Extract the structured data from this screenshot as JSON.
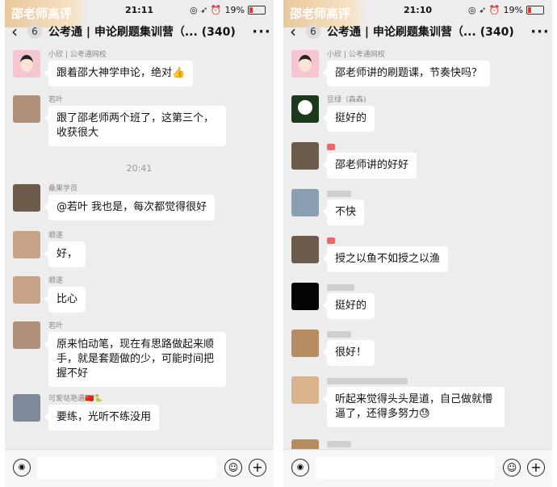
{
  "phones": [
    {
      "status": {
        "time": "21:11",
        "icons": "◎ ➶ ⏰",
        "battery": "19%"
      },
      "watermark": "邵老师高评",
      "nav": {
        "unread": "6",
        "title": "公考通 | 申论刷题集训营（...",
        "count": "(340)"
      },
      "time_separator": "20:41",
      "messages": [
        {
          "sender": "小欣 | 公考通网校",
          "text": "跟着邵大神学申论，绝对👍",
          "avatar": "avatar-pink-cartoon"
        },
        {
          "sender": "若叶",
          "text": "跟了邵老师两个班了，这第三个，收获很大",
          "avatar": "avatar-dog"
        },
        {
          "sender": "桑果学员",
          "text": "@若叶 我也是，每次都觉得很好",
          "avatar": "avatar-girl"
        },
        {
          "sender": "顺遂",
          "text": "好，",
          "avatar": "avatar-brown"
        },
        {
          "sender": "顺遂",
          "text": "比心",
          "avatar": "avatar-brown"
        },
        {
          "sender": "若叶",
          "text": "原来怕动笔，现在有思路做起来顺手，就是套题做的少，可能时间把握不好",
          "avatar": "avatar-dog"
        },
        {
          "sender": "可爱哒艳遇🇨🇳🐍",
          "text": "要练，光听不练没用",
          "avatar": "avatar-man"
        }
      ]
    },
    {
      "status": {
        "time": "21:10",
        "icons": "◎ ➶ ⏰",
        "battery": "19%"
      },
      "watermark": "邵老师高评",
      "nav": {
        "unread": "6",
        "title": "公考通 | 申论刷题集训营（...",
        "count": "(340)"
      },
      "messages": [
        {
          "sender": "小欣 | 公考通网校",
          "text": "邵老师讲的刷题课，节奏快吗？",
          "avatar": "avatar-pink-cartoon"
        },
        {
          "sender": "豆绿（森森)",
          "text": "挺好的",
          "avatar": "avatar-panda"
        },
        {
          "sender": "",
          "text": "邵老师讲的好好",
          "avatar": "avatar-girl-dark"
        },
        {
          "sender": "",
          "text": "不快",
          "avatar": "avatar-sea"
        },
        {
          "sender": "",
          "text": "授之以鱼不如授之以渔",
          "avatar": "avatar-girl-dark"
        },
        {
          "sender": "",
          "text": "挺好的",
          "avatar": "avatar-black"
        },
        {
          "sender": "",
          "text": "很好！",
          "avatar": "avatar-anime"
        },
        {
          "sender": "",
          "text": "听起来觉得头头是道，自己做就懵逼了，还得多努力😓",
          "avatar": "avatar-face"
        }
      ]
    }
  ]
}
